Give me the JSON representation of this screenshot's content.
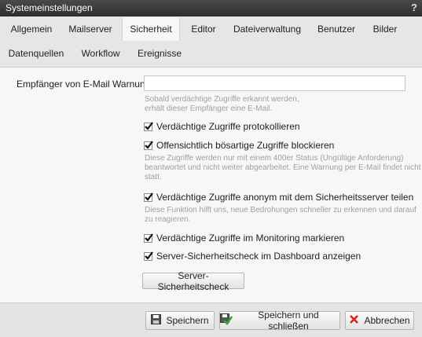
{
  "window": {
    "title": "Systemeinstellungen",
    "help_label": "?"
  },
  "tabs": [
    {
      "label": "Allgemein",
      "active": false
    },
    {
      "label": "Mailserver",
      "active": false
    },
    {
      "label": "Sicherheit",
      "active": true
    },
    {
      "label": "Editor",
      "active": false
    },
    {
      "label": "Dateiverwaltung",
      "active": false
    },
    {
      "label": "Benutzer",
      "active": false
    },
    {
      "label": "Bilder",
      "active": false
    },
    {
      "label": "Datenquellen",
      "active": false
    },
    {
      "label": "Workflow",
      "active": false
    },
    {
      "label": "Ereignisse",
      "active": false
    }
  ],
  "security": {
    "email_label": "Empfänger von E-Mail Warnungen",
    "email_value": "",
    "email_hint_line1": "Sobald verdächtige Zugriffe erkannt werden,",
    "email_hint_line2": "erhält dieser Empfänger eine E-Mail.",
    "options": [
      {
        "label": "Verdächtige Zugriffe protokollieren",
        "checked": true
      },
      {
        "label": "Offensichtlich bösartige Zugriffe blockieren",
        "checked": true,
        "hint_line1": "Diese Zugriffe werden nur mit einem 400er Status (Ungültige Anforderung)",
        "hint_line2": "beantwortet und nicht weiter abgearbeitet. Eine Warnung per E-Mail findet nicht",
        "hint_line3": "statt."
      },
      {
        "label": "Verdächtige Zugriffe anonym mit dem Sicherheitsserver teilen",
        "checked": true,
        "hint_line1": "Diese Funktion hilft uns, neue Bedrohungen schneller zu erkennen und darauf",
        "hint_line2": "zu reagieren."
      },
      {
        "label": "Verdächtige Zugriffe im Monitoring markieren",
        "checked": true
      },
      {
        "label": "Server-Sicherheitscheck im Dashboard anzeigen",
        "checked": true
      }
    ],
    "check_button_label": "Server-Sicherheitscheck"
  },
  "footer": {
    "save_label": "Speichern",
    "save_close_label": "Speichern und schließen",
    "cancel_label": "Abbrechen"
  },
  "colors": {
    "titlebar": "#333333",
    "checkmark": "#111111",
    "cancel_x": "#d42020",
    "save_close_check": "#3aa23a"
  }
}
